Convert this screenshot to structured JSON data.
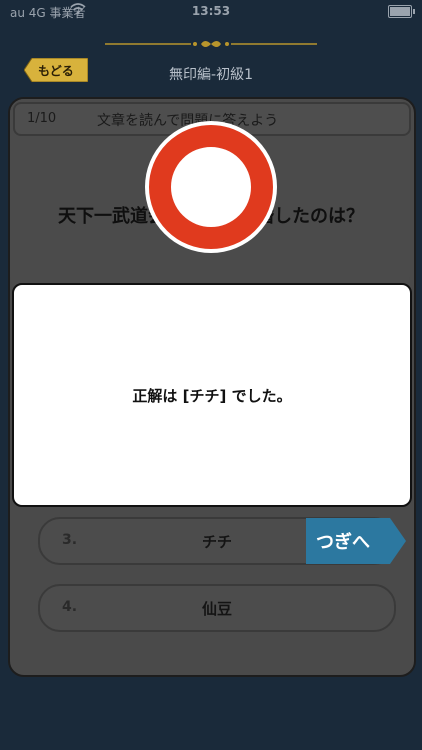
{
  "status_bar": {
    "carrier": "au 4G 事業者",
    "time": "13:53"
  },
  "header": {
    "back_label": "もどる",
    "title": "無印編-初級1"
  },
  "question": {
    "number": "1/10",
    "prompt": "文章を読んで問題に答えよう",
    "text": "天下一武道会で悟空と結婚したのは？"
  },
  "answers": [
    {
      "number": "3.",
      "text": "チチ"
    },
    {
      "number": "4.",
      "text": "仙豆"
    }
  ],
  "next_button": {
    "label": "つぎへ"
  },
  "result": {
    "message": "正解は [チチ] でした。",
    "mark_icon": "correct-circle-icon"
  },
  "colors": {
    "background": "#1a2a3a",
    "back_button": "#d8b23c",
    "next_button": "#2c78a0",
    "correct_mark": "#e03a1e"
  }
}
